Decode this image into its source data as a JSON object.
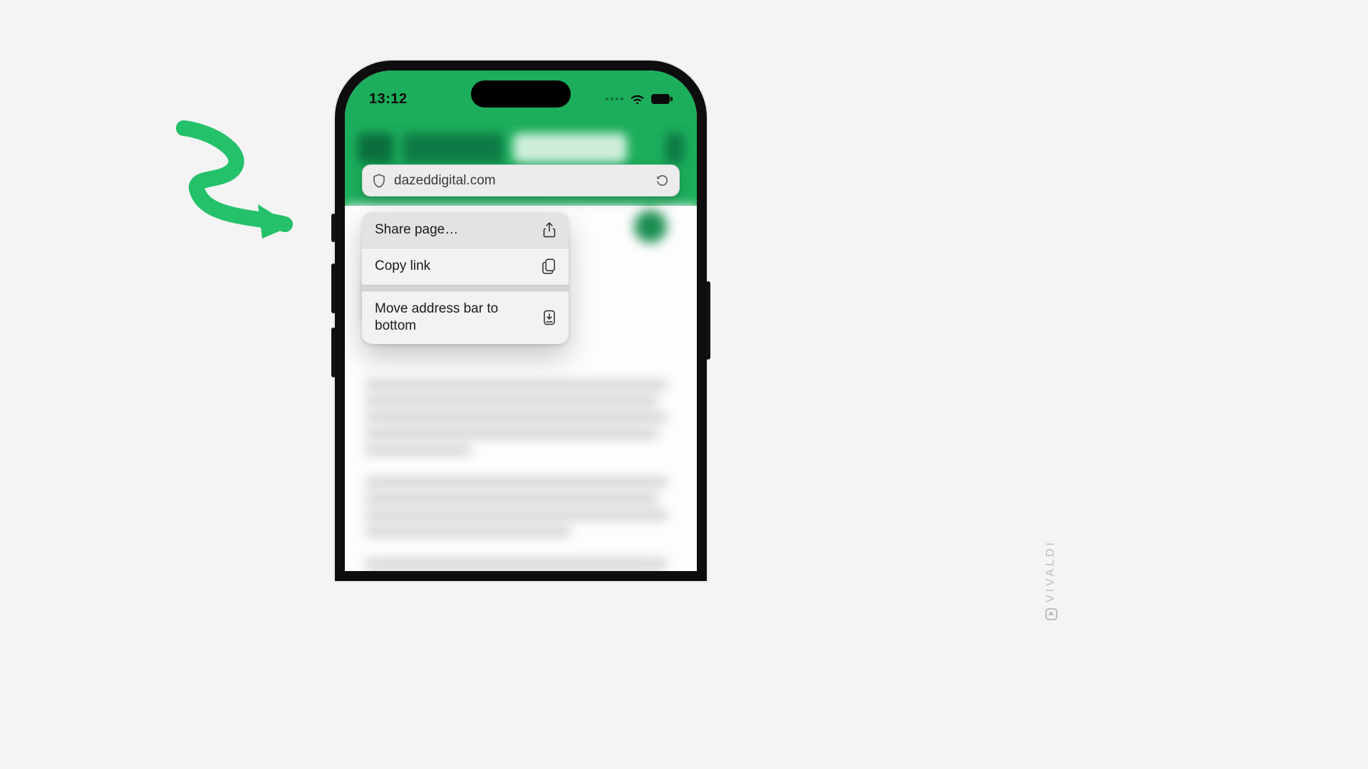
{
  "status": {
    "time": "13:12"
  },
  "address_bar": {
    "url": "dazeddigital.com"
  },
  "context_menu": {
    "share": "Share page…",
    "copy": "Copy link",
    "move": "Move address bar to bottom"
  },
  "brand": {
    "name": "VIVALDI"
  },
  "colors": {
    "accent": "#1CAE5C",
    "arrow": "#24C06A"
  }
}
